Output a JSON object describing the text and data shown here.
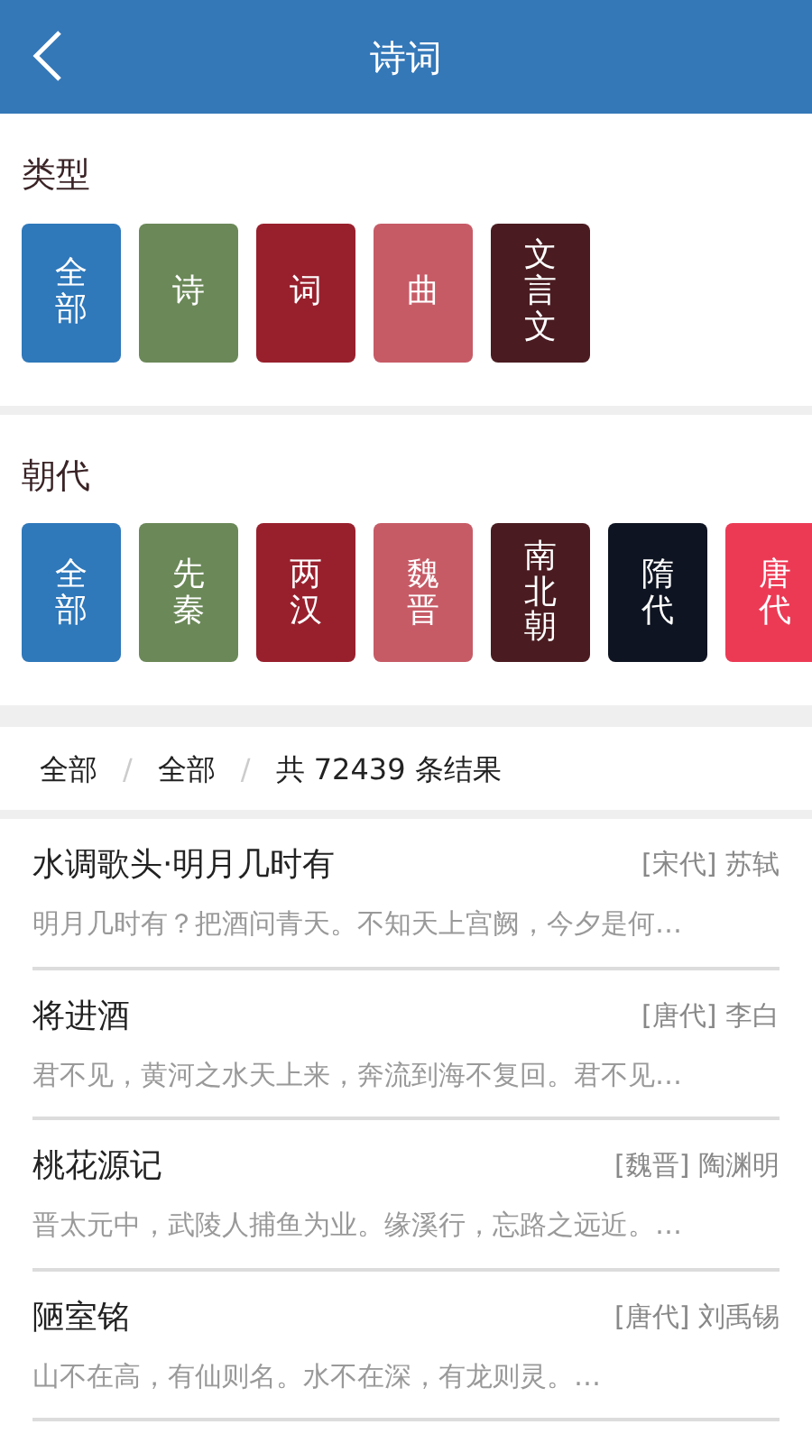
{
  "header": {
    "title": "诗词"
  },
  "filters": [
    {
      "label": "类型",
      "chips": [
        {
          "text": "全部",
          "color": "#2f78ba"
        },
        {
          "text": "诗",
          "color": "#6b8858"
        },
        {
          "text": "词",
          "color": "#98202d"
        },
        {
          "text": "曲",
          "color": "#c65b66"
        },
        {
          "text": "文言文",
          "color": "#4a1c21"
        }
      ]
    },
    {
      "label": "朝代",
      "chips": [
        {
          "text": "全部",
          "color": "#2f78ba"
        },
        {
          "text": "先秦",
          "color": "#6b8858"
        },
        {
          "text": "两汉",
          "color": "#98202d"
        },
        {
          "text": "魏晋",
          "color": "#c65b66"
        },
        {
          "text": "南北朝",
          "color": "#4a1c21"
        },
        {
          "text": "隋代",
          "color": "#0f1422"
        },
        {
          "text": "唐代",
          "color": "#ec3a55"
        }
      ]
    }
  ],
  "breadcrumb": [
    {
      "kind": "crumb",
      "text": "全部"
    },
    {
      "kind": "separator",
      "text": "/"
    },
    {
      "kind": "crumb",
      "text": "全部"
    },
    {
      "kind": "separator",
      "text": "/"
    },
    {
      "kind": "count",
      "text": "共 72439 条结果"
    }
  ],
  "results": [
    {
      "title": "水调歌头·明月几时有",
      "author": "[宋代] 苏轼",
      "excerpt": "明月几时有？把酒问青天。不知天上宫阙，今夕是何…"
    },
    {
      "title": "将进酒",
      "author": "[唐代] 李白",
      "excerpt": "君不见，黄河之水天上来，奔流到海不复回。君不见…"
    },
    {
      "title": "桃花源记",
      "author": "[魏晋] 陶渊明",
      "excerpt": "晋太元中，武陵人捕鱼为业。缘溪行，忘路之远近。…"
    },
    {
      "title": "陋室铭",
      "author": "[唐代] 刘禹锡",
      "excerpt": "山不在高，有仙则名。水不在深，有龙则灵。…"
    }
  ]
}
